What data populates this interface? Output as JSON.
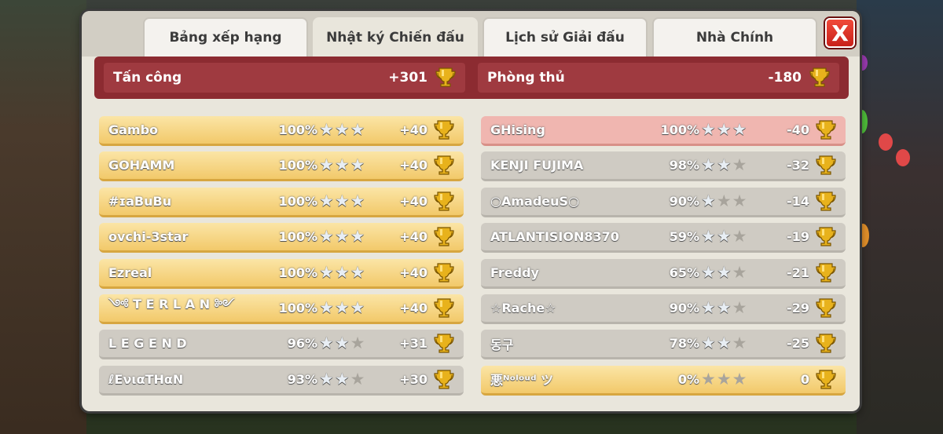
{
  "tabs": [
    {
      "label": "Bảng xếp hạng"
    },
    {
      "label": "Nhật ký Chiến đấu"
    },
    {
      "label": "Lịch sử Giải đấu"
    },
    {
      "label": "Nhà Chính"
    }
  ],
  "active_tab": 1,
  "close_label": "X",
  "summary": {
    "attack": {
      "label": "Tấn công",
      "value": "+301"
    },
    "defense": {
      "label": "Phòng thủ",
      "value": "-180"
    }
  },
  "attacks": [
    {
      "name": "Gambo",
      "percent": "100%",
      "stars": 3,
      "trophies": "+40",
      "style": "gold"
    },
    {
      "name": "GOHAMM",
      "percent": "100%",
      "stars": 3,
      "trophies": "+40",
      "style": "gold"
    },
    {
      "name": "#ɪaBuBu",
      "percent": "100%",
      "stars": 3,
      "trophies": "+40",
      "style": "gold"
    },
    {
      "name": "ovchi-3star",
      "percent": "100%",
      "stars": 3,
      "trophies": "+40",
      "style": "gold"
    },
    {
      "name": "Ezreal",
      "percent": "100%",
      "stars": 3,
      "trophies": "+40",
      "style": "gold"
    },
    {
      "name": "༺ T E R L A N ༻",
      "percent": "100%",
      "stars": 3,
      "trophies": "+40",
      "style": "gold"
    },
    {
      "name": "L E G E N D",
      "percent": "96%",
      "stars": 2,
      "trophies": "+31",
      "style": "grey"
    },
    {
      "name": "ℓEνιαTHαN",
      "percent": "93%",
      "stars": 2,
      "trophies": "+30",
      "style": "grey"
    }
  ],
  "defenses": [
    {
      "name": "GHising",
      "percent": "100%",
      "stars": 3,
      "trophies": "-40",
      "style": "red"
    },
    {
      "name": "KENJI FUJIMA",
      "percent": "98%",
      "stars": 2,
      "trophies": "-32",
      "style": "grey"
    },
    {
      "name": "○AmadeuS○",
      "percent": "90%",
      "stars": 1,
      "trophies": "-14",
      "style": "grey"
    },
    {
      "name": "ATLANTISION8370",
      "percent": "59%",
      "stars": 2,
      "trophies": "-19",
      "style": "grey"
    },
    {
      "name": "Freddy",
      "percent": "65%",
      "stars": 2,
      "trophies": "-21",
      "style": "grey"
    },
    {
      "name": "☆Rache☆",
      "percent": "90%",
      "stars": 2,
      "trophies": "-29",
      "style": "grey"
    },
    {
      "name": "동구",
      "percent": "78%",
      "stars": 2,
      "trophies": "-25",
      "style": "grey"
    },
    {
      "name": "悪ᴺᵒˡᵒᵘᵈ ツ",
      "percent": "0%",
      "stars": 0,
      "trophies": "0",
      "style": "gold"
    }
  ],
  "colors": {
    "accent_red": "#8c2b31",
    "gold_row": "#f2c96a",
    "grey_row": "#cfcbc3",
    "red_row": "#f0b6b0"
  }
}
